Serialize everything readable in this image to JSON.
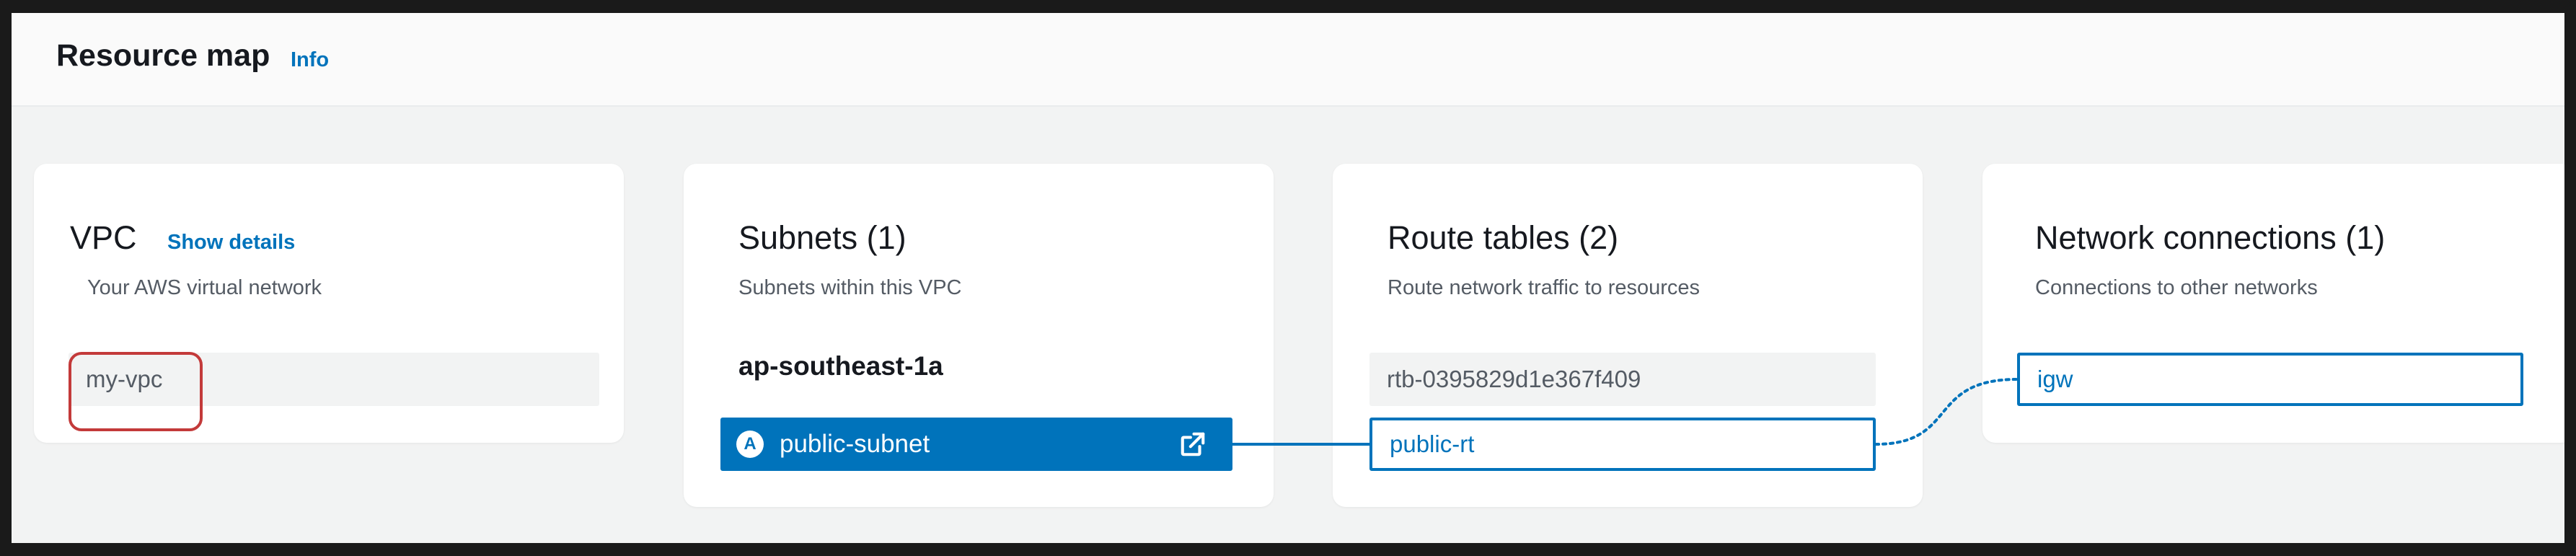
{
  "header": {
    "title": "Resource map",
    "info_link": "Info"
  },
  "vpc": {
    "title": "VPC",
    "show_details": "Show details",
    "subtitle": "Your AWS virtual network",
    "item": "my-vpc"
  },
  "subnets": {
    "title": "Subnets (1)",
    "subtitle": "Subnets within this VPC",
    "availability_zone": "ap-southeast-1a",
    "item": {
      "badge": "A",
      "label": "public-subnet",
      "icon": "external-link-icon"
    }
  },
  "route_tables": {
    "title": "Route tables (2)",
    "subtitle": "Route network traffic to resources",
    "items": [
      "rtb-0395829d1e367f409",
      "public-rt"
    ]
  },
  "network_connections": {
    "title": "Network connections (1)",
    "subtitle": "Connections to other networks",
    "items": [
      "igw"
    ]
  },
  "colors": {
    "accent": "#0073bb",
    "highlight": "#c33a3a",
    "background": "#f2f3f3"
  }
}
